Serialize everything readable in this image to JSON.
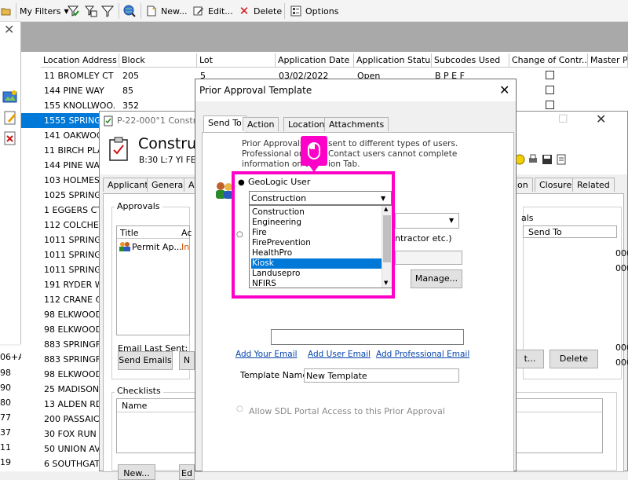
{
  "toolbar": {
    "my_filters": "My Filters",
    "new_label": "New...",
    "edit_label": "Edit...",
    "delete_label": "Delete",
    "options_label": "Options"
  },
  "grid": {
    "columns": [
      "Location Address",
      "Block",
      "Lot",
      "Application Date",
      "Application Status",
      "Subcodes Used",
      "Change of Contr...",
      "Master Pe"
    ],
    "rows": [
      {
        "addr": "11 BROMLEY CT",
        "block": "205",
        "lot": "5",
        "date": "03/02/2022",
        "status": "Open",
        "subcodes": "B P E F"
      },
      {
        "addr": "144 PINE WAY",
        "block": "85",
        "lot": "",
        "date": "",
        "status": "",
        "subcodes": ""
      },
      {
        "addr": "155 KNOLLWOO...",
        "block": "352",
        "lot": "",
        "date": "",
        "status": "",
        "subcodes": ""
      },
      {
        "addr": "1555 SPRINGF",
        "block": "",
        "lot": "",
        "date": "",
        "status": "",
        "subcodes": ""
      },
      {
        "addr": "141 OAKWOOD",
        "block": "",
        "lot": "",
        "date": "",
        "status": "",
        "subcodes": ""
      },
      {
        "addr": "11 BIRCH PLAC",
        "block": "",
        "lot": "",
        "date": "",
        "status": "",
        "subcodes": ""
      },
      {
        "addr": "144 PINE WAY",
        "block": "",
        "lot": "",
        "date": "",
        "status": "",
        "subcodes": ""
      },
      {
        "addr": "103 HOLMES O",
        "block": "",
        "lot": "",
        "date": "",
        "status": "",
        "subcodes": ""
      },
      {
        "addr": "1025 SPRINGFI",
        "block": "",
        "lot": "",
        "date": "",
        "status": "",
        "subcodes": ""
      },
      {
        "addr": "1 EGGERS CT",
        "block": "",
        "lot": "",
        "date": "",
        "status": "",
        "subcodes": ""
      },
      {
        "addr": "112 COLCHEST",
        "block": "",
        "lot": "",
        "date": "",
        "status": "",
        "subcodes": ""
      },
      {
        "addr": "1011 SPRINGF",
        "block": "",
        "lot": "",
        "date": "",
        "status": "",
        "subcodes": ""
      },
      {
        "addr": "1011 SPRINGF",
        "block": "",
        "lot": "",
        "date": "",
        "status": "",
        "subcodes": ""
      },
      {
        "addr": "1011 SPRINGF",
        "block": "",
        "lot": "",
        "date": "",
        "status": "",
        "subcodes": ""
      },
      {
        "addr": "191 RYDER WA",
        "block": "",
        "lot": "",
        "date": "",
        "status": "",
        "subcodes": ""
      },
      {
        "addr": "112 CRANE CIR",
        "block": "",
        "lot": "",
        "date": "",
        "status": "",
        "subcodes": ""
      },
      {
        "addr": "98 ELKWOOD A",
        "block": "",
        "lot": "",
        "date": "",
        "status": "",
        "subcodes": ""
      },
      {
        "addr": "98 ELKWOOD A",
        "block": "",
        "lot": "",
        "date": "",
        "status": "",
        "subcodes": ""
      },
      {
        "addr": "883 SPRINGFIE",
        "block": "",
        "lot": "",
        "date": "",
        "status": "",
        "subcodes": ""
      },
      {
        "addr": "883 SPRINGFIE",
        "block": "",
        "lot": "",
        "date": "",
        "status": "",
        "subcodes": ""
      },
      {
        "addr": "98 ELKWOOD A",
        "block": "",
        "lot": "",
        "date": "",
        "status": "",
        "subcodes": ""
      },
      {
        "addr": "25 MADISON A",
        "block": "",
        "lot": "",
        "date": "",
        "status": "",
        "subcodes": ""
      },
      {
        "addr": "13 ALDEN RD",
        "block": "",
        "lot": "",
        "date": "",
        "status": "",
        "subcodes": ""
      },
      {
        "addr": "200 PASSAIC S",
        "block": "",
        "lot": "",
        "date": "",
        "status": "",
        "subcodes": ""
      },
      {
        "addr": "30 FOX RUN",
        "block": "",
        "lot": "",
        "date": "",
        "status": "",
        "subcodes": ""
      },
      {
        "addr": "50 UNION AVE",
        "block": "",
        "lot": "",
        "date": "",
        "status": "",
        "subcodes": ""
      },
      {
        "addr": "6 SOUTHGATE",
        "block": "",
        "lot": "",
        "date": "",
        "status": "",
        "subcodes": ""
      }
    ],
    "left_numbers": [
      "06+A",
      "98",
      "90",
      "80",
      "77",
      "37",
      "11",
      "19"
    ],
    "right_edge": [
      "000",
      "000",
      "000",
      "000"
    ]
  },
  "construction_window": {
    "title": "P-22-000°1 Constru",
    "heading": "Construc",
    "subheading": "B:30 L:7  YI FE",
    "tabs": [
      "Applicant",
      "General",
      "A"
    ],
    "right_tabs": [
      "on",
      "Closure",
      "Related"
    ],
    "approvals_label": "Approvals",
    "approvals_cols": [
      "Title",
      "Ac"
    ],
    "approvals_row_title": "Permit Ap...",
    "approvals_row_status": "In",
    "right_group_label": "als",
    "right_col": "Send To",
    "email_last_sent": "Email Last Sent:",
    "send_emails": "Send Emails",
    "n_button": "N",
    "t_button": "t...",
    "delete_button": "Delete",
    "checklists_label": "Checklists",
    "name_col": "Name",
    "new_button": "New...",
    "ed_button": "Ed"
  },
  "dialog": {
    "title": "Prior Approval Template",
    "tabs": [
      "Send To",
      "Action",
      "Location",
      "Attachments"
    ],
    "info_text_1": "Prior Approvals",
    "info_text_1b": "sent to different types of users.",
    "info_text_2": "Professional or",
    "info_text_2b": "Contact users cannot complete",
    "info_text_3": "information on t",
    "info_text_3b": "ion Tab.",
    "radio_geologic": "GeoLogic User",
    "dropdown_value": "Construction",
    "options": [
      "Construction",
      "Engineering",
      "Fire",
      "FirePrevention",
      "HealthPro",
      "Kiosk",
      "Landusepro",
      "NFIRS"
    ],
    "selected_option": "Kiosk",
    "radio_other_text": "ntractor etc.)",
    "manage_button": "Manage...",
    "add_your_email": "Add Your Email",
    "add_user_email": "Add User Email",
    "add_professional_email": "Add Professional Email",
    "template_name_label": "Template Name",
    "template_name_value": "New Template",
    "sdl_portal": "Allow SDL Portal Access to this Prior Approval"
  },
  "colors": {
    "highlight": "#ff00c8",
    "selection": "#0078d7",
    "link": "#0645ad"
  }
}
